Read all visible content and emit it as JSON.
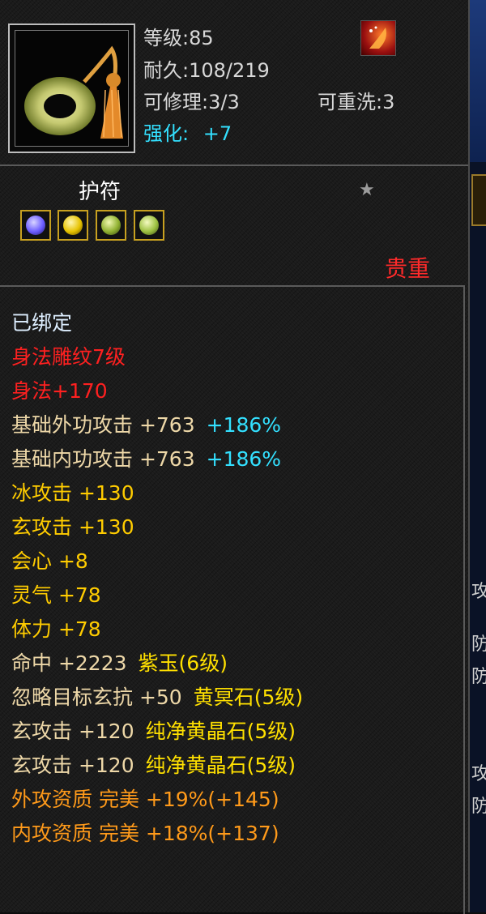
{
  "item": {
    "icon": "jade-ring-amulet-icon",
    "level_text": "等级:85",
    "durability_text": "耐久:108/219",
    "repair_text": "可修理:3/3",
    "rewash_text": "可重洗:3",
    "enhance_label": "强化:",
    "enhance_value": "+7",
    "effect_icon": "fire-effect-icon"
  },
  "amulet": {
    "label": "护符",
    "star_icon": "star-icon",
    "gems": [
      {
        "icon": "purple-gem-icon",
        "color": "#6b5cff"
      },
      {
        "icon": "yellow-gem-icon",
        "color": "#e6c200"
      },
      {
        "icon": "green-gem-icon",
        "color": "#8fb030"
      },
      {
        "icon": "green-gem-icon",
        "color": "#9cc040"
      }
    ],
    "rarity": "贵重"
  },
  "stats": [
    {
      "text": "已绑定",
      "color": "white"
    },
    {
      "text": "身法雕纹7级",
      "color": "red"
    },
    {
      "text": "身法+170",
      "color": "red"
    },
    {
      "text": "基础外功攻击 +763",
      "extra": "+186%",
      "color": "beige",
      "extra_color": "cyan"
    },
    {
      "text": "基础内功攻击 +763",
      "extra": "+186%",
      "color": "beige",
      "extra_color": "cyan"
    },
    {
      "text": "冰攻击 +130",
      "color": "yellow"
    },
    {
      "text": "玄攻击 +130",
      "color": "yellow"
    },
    {
      "text": "会心 +8",
      "color": "yellow"
    },
    {
      "text": "灵气 +78",
      "color": "yellow"
    },
    {
      "text": "体力 +78",
      "color": "yellow"
    },
    {
      "text": "命中 +2223",
      "extra": "紫玉(6级)",
      "color": "beige",
      "extra_color": "gemtxt"
    },
    {
      "text": "忽略目标玄抗 +50",
      "extra": "黄冥石(5级)",
      "color": "beige",
      "extra_color": "gemtxt"
    },
    {
      "text": "玄攻击 +120",
      "extra": "纯净黄晶石(5级)",
      "color": "beige",
      "extra_color": "gemtxt"
    },
    {
      "text": "玄攻击 +120",
      "extra": "纯净黄晶石(5级)",
      "color": "beige",
      "extra_color": "gemtxt"
    },
    {
      "text": "外攻资质 完美 +19%(+145)",
      "color": "orange"
    },
    {
      "text": "内攻资质 完美 +18%(+137)",
      "color": "orange"
    }
  ],
  "colors": {
    "white": "#ddeeff",
    "red": "#ff2020",
    "beige": "#eed8a8",
    "yellow": "#ffcc00",
    "orange": "#ff9a1a",
    "cyan": "#33e0ff",
    "gemtxt": "#ffe000"
  },
  "side_panel_glyphs": [
    "攻",
    "防",
    "防",
    "攻",
    "防"
  ]
}
